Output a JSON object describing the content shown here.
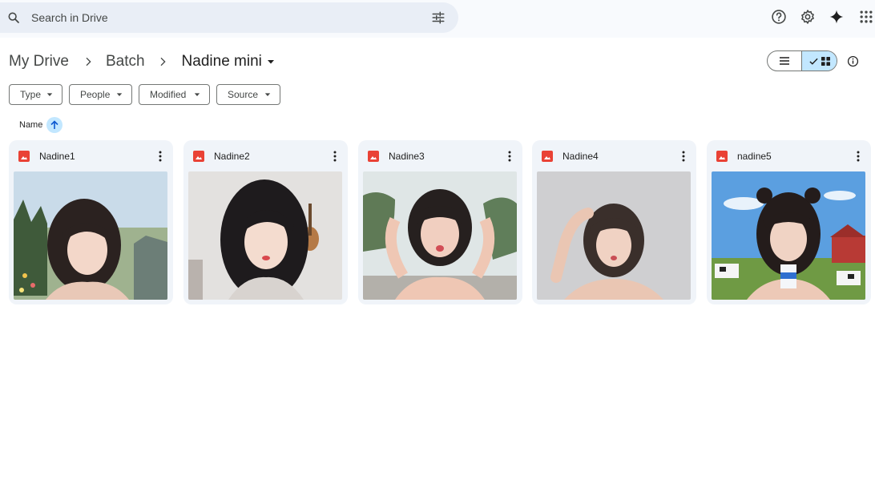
{
  "search": {
    "placeholder": "Search in Drive"
  },
  "header_icons": [
    "help-icon",
    "settings-icon",
    "gemini-icon",
    "apps-icon"
  ],
  "breadcrumb": {
    "items": [
      "My Drive",
      "Batch"
    ],
    "current": "Nadine mini"
  },
  "filters": [
    "Type",
    "People",
    "Modified",
    "Source"
  ],
  "sort": {
    "label": "Name",
    "direction": "ascending"
  },
  "files": [
    {
      "name": "Nadine1"
    },
    {
      "name": "Nadine2"
    },
    {
      "name": "Nadine3"
    },
    {
      "name": "Nadine4"
    },
    {
      "name": "nadine5"
    }
  ],
  "colors": {
    "accent": "#c2e7ff",
    "image_icon": "#e94235",
    "card_bg": "#f0f4f9"
  }
}
